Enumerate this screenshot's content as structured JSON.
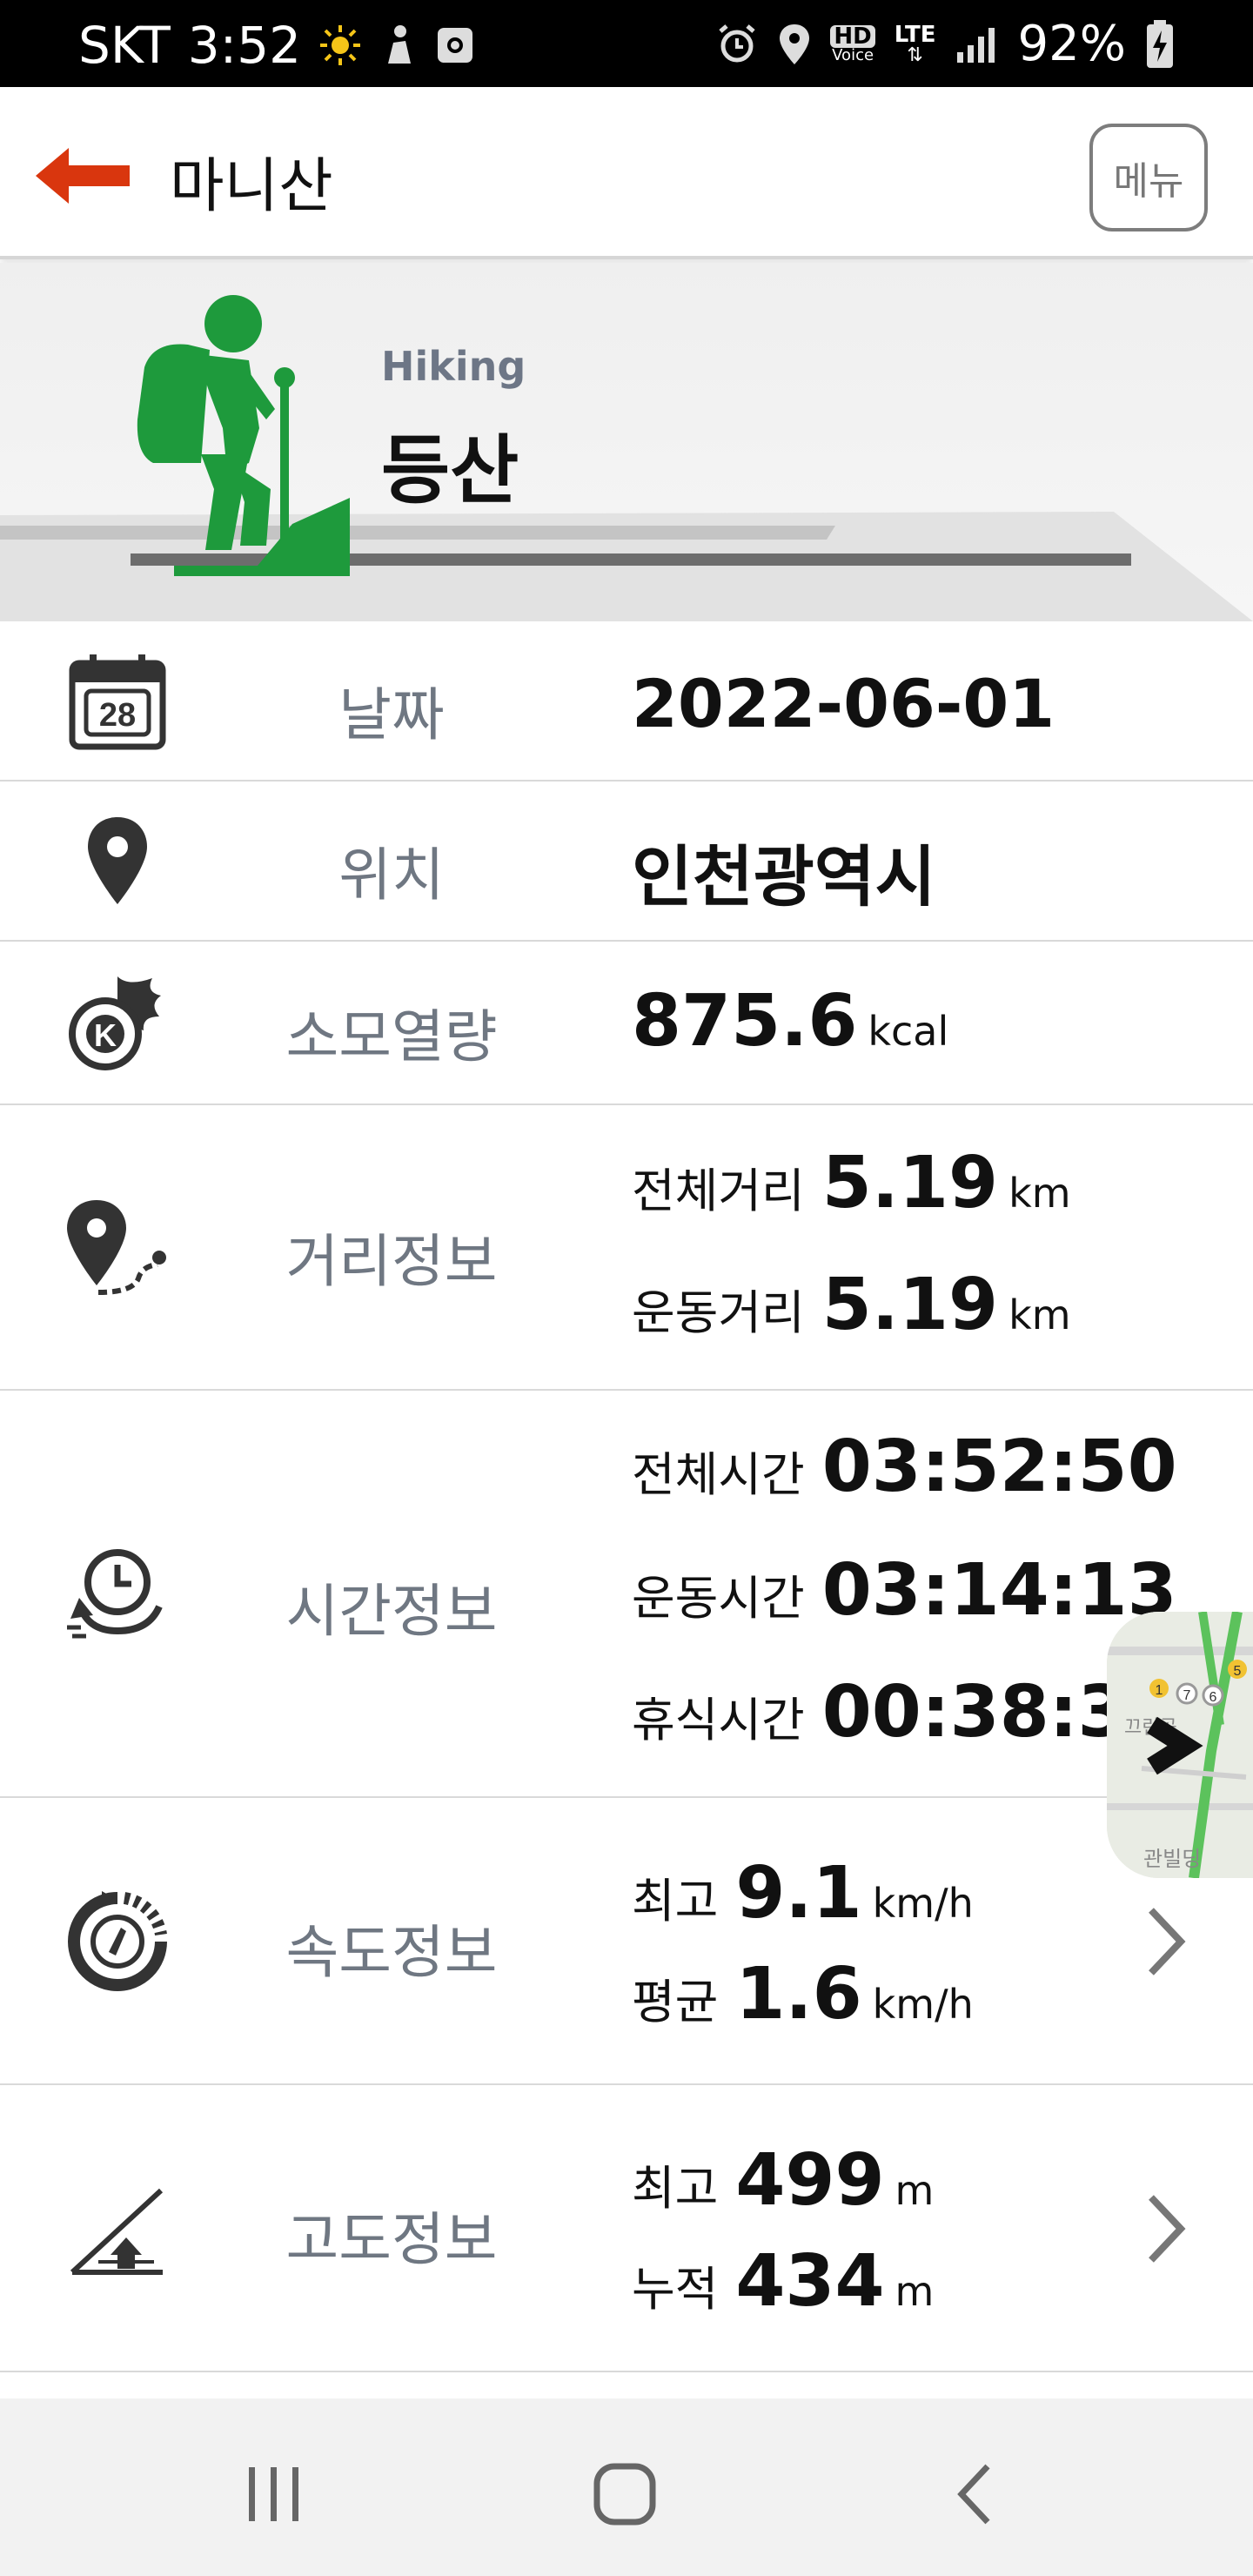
{
  "status_bar": {
    "carrier": "SKT",
    "time": "3:52",
    "icons_left": [
      "sun-icon",
      "person-notification-icon",
      "camera-app-icon"
    ],
    "icons_right": [
      "alarm-icon",
      "location-icon",
      "hd-voice-icon",
      "lte-icon",
      "signal-icon",
      "battery-charging-icon"
    ],
    "hd_label": "HD",
    "voice_label": "Voice",
    "lte_label": "LTE",
    "battery": "92%"
  },
  "header": {
    "title": "마니산",
    "menu_label": "메뉴",
    "back_icon": "back-arrow-icon"
  },
  "hero": {
    "subtitle": "Hiking",
    "title": "등산",
    "icon": "hiker-icon"
  },
  "rows": {
    "date": {
      "label": "날짜",
      "value": "2022-06-01",
      "icon": "calendar-icon",
      "icon_text": "28"
    },
    "location": {
      "label": "위치",
      "value": "인천광역시",
      "icon": "location-pin-icon"
    },
    "calories": {
      "label": "소모열량",
      "value": "875.6",
      "unit": "kcal",
      "icon": "calorie-fire-icon",
      "icon_text": "K"
    },
    "distance": {
      "label": "거리정보",
      "icon": "distance-route-icon",
      "lines": [
        {
          "label": "전체거리",
          "value": "5.19",
          "unit": "km"
        },
        {
          "label": "운동거리",
          "value": "5.19",
          "unit": "km"
        }
      ]
    },
    "time": {
      "label": "시간정보",
      "icon": "time-clock-icon",
      "lines": [
        {
          "label": "전체시간",
          "value": "03:52:50"
        },
        {
          "label": "운동시간",
          "value": "03:14:13"
        },
        {
          "label": "휴식시간",
          "value": "00:38:3"
        }
      ]
    },
    "speed": {
      "label": "속도정보",
      "icon": "speedometer-icon",
      "lines": [
        {
          "label": "최고",
          "value": "9.1",
          "unit": "km/h"
        },
        {
          "label": "평균",
          "value": "1.6",
          "unit": "km/h"
        }
      ]
    },
    "altitude": {
      "label": "고도정보",
      "icon": "altitude-slope-icon",
      "lines": [
        {
          "label": "최고",
          "value": "499",
          "unit": "m"
        },
        {
          "label": "누적",
          "value": "434",
          "unit": "m"
        }
      ]
    }
  },
  "map_thumb": {
    "text_1": "끄린공",
    "text_2": "관빌딩",
    "markers": [
      "1",
      "7",
      "6",
      "5"
    ]
  },
  "nav_bar": {
    "icons": [
      "recent-apps-icon",
      "home-icon",
      "back-icon"
    ]
  },
  "colors": {
    "accent": "#d9360e",
    "hiker_green": "#1e9a3c",
    "label_gray": "#6f7782"
  }
}
